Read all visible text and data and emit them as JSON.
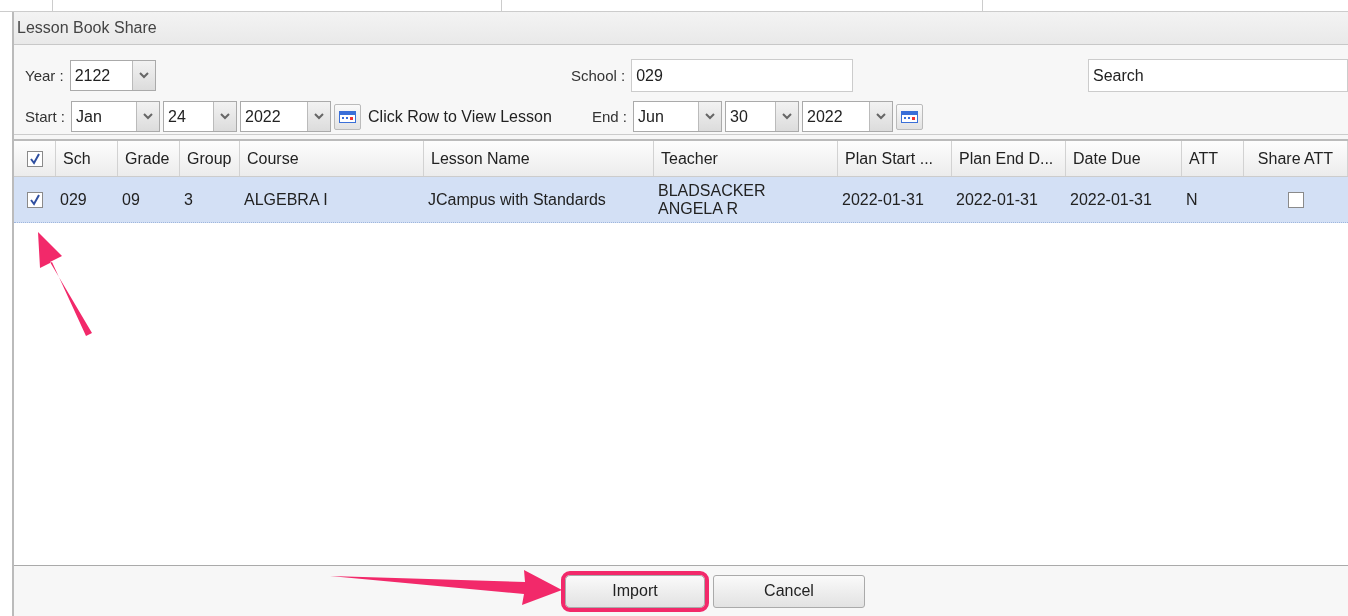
{
  "window": {
    "title": "Lesson Book Share"
  },
  "filters": {
    "year": {
      "label": "Year :",
      "value": "2122"
    },
    "school": {
      "label": "School :",
      "value": "029"
    },
    "search": {
      "placeholder": "Search"
    },
    "start": {
      "label": "Start :",
      "month": "Jan",
      "day": "24",
      "year": "2022"
    },
    "hint": "Click Row to View Lesson",
    "end": {
      "label": "End :",
      "month": "Jun",
      "day": "30",
      "year": "2022"
    }
  },
  "table": {
    "select_all": {
      "checked": true
    },
    "columns": [
      "Sch",
      "Grade",
      "Group",
      "Course",
      "Lesson Name",
      "Teacher",
      "Plan Start ...",
      "Plan End D...",
      "Date Due",
      "ATT",
      "Share ATT"
    ],
    "rows": [
      {
        "selected": true,
        "checked": true,
        "cells": [
          "029",
          "09",
          "3",
          "ALGEBRA I",
          "JCampus with Standards",
          "BLADSACKER ANGELA R",
          "2022-01-31",
          "2022-01-31",
          "2022-01-31",
          "N"
        ],
        "share_att": {
          "checked": false
        }
      }
    ]
  },
  "buttons": [
    {
      "label": "Import",
      "highlighted": true
    },
    {
      "label": "Cancel",
      "highlighted": false
    }
  ]
}
